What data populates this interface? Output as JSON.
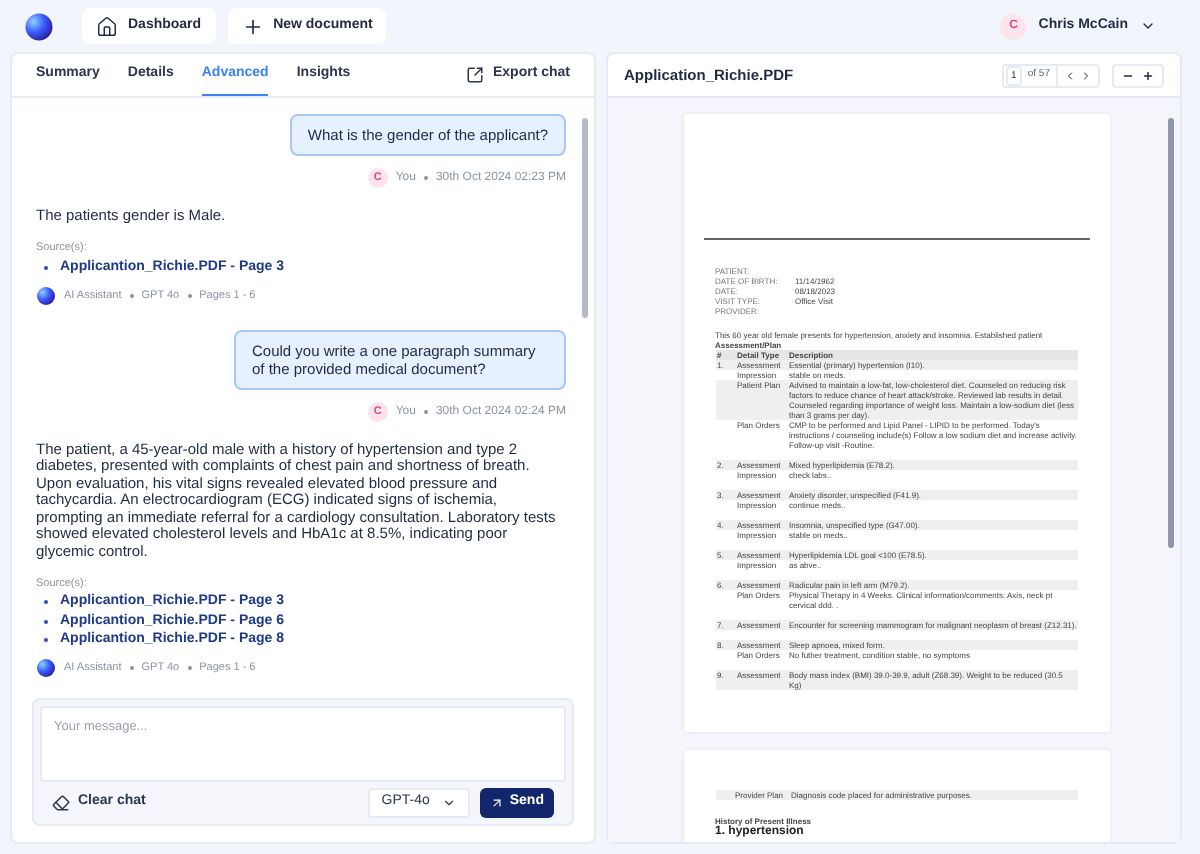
{
  "nav": {
    "buttons": [
      {
        "kind": "home",
        "label": "Dashboard"
      },
      {
        "kind": "plus",
        "label": "New document"
      }
    ],
    "user": {
      "initial": "C",
      "name": "Chris McCain"
    }
  },
  "chat": {
    "tabs": [
      {
        "label": "Summary",
        "selected": false
      },
      {
        "label": "Details",
        "selected": false
      },
      {
        "label": "Advanced",
        "selected": true
      },
      {
        "label": "Insights",
        "selected": false
      }
    ],
    "export": "Export chat",
    "messages": [
      {
        "kind": "user",
        "text": "What is the gender of the applicant?",
        "initial": "C",
        "author": "You",
        "time": "30th Oct 2024 02:23 PM"
      },
      {
        "kind": "assistant",
        "text": "The patients gender is Male.",
        "sources_label": "Source(s):",
        "sources": [
          "Applicantion_Richie.PDF - Page 3"
        ],
        "author": "AI Assistant",
        "model": "GPT 4o",
        "pages": "Pages 1 - 6"
      },
      {
        "kind": "user",
        "text": "Could you write a one paragraph summary of the provided medical document?",
        "initial": "C",
        "author": "You",
        "time": "30th Oct 2024 02:24 PM"
      },
      {
        "kind": "assistant",
        "text": "The patient, a 45-year-old male with a history of hypertension and type 2 diabetes, presented with complaints of chest pain and shortness of breath. Upon evaluation, his vital signs revealed elevated blood pressure and tachycardia. An electrocardiogram (ECG) indicated signs of ischemia, prompting an immediate referral for a cardiology consultation. Laboratory tests showed elevated cholesterol levels and HbA1c at 8.5%, indicating poor glycemic control.",
        "sources_label": "Source(s):",
        "sources": [
          "Applicantion_Richie.PDF - Page 3",
          "Applicantion_Richie.PDF - Page 6",
          "Applicantion_Richie.PDF - Page 8"
        ],
        "author": "AI Assistant",
        "model": "GPT 4o",
        "pages": "Pages 1 - 6"
      }
    ],
    "composer": {
      "placeholder": "Your message...",
      "clear": "Clear chat",
      "model": "GPT-4o",
      "send": "Send"
    }
  },
  "viewer": {
    "title": "Application_Richie.PDF",
    "page": "1",
    "of": "of 57",
    "page1": {
      "fields": [
        {
          "label": "PATIENT:"
        },
        {
          "label": "DATE OF BIRTH:",
          "value": "11/14/1962"
        },
        {
          "label": "DATE:",
          "value": "08/18/2023"
        },
        {
          "label": "VISIT TYPE:",
          "value": "Office Visit"
        },
        {
          "label": "PROVIDER:"
        }
      ],
      "intro": "This 60 year old female presents for hypertension, anxiety and insomnia. Established patient",
      "section": "Assessment/Plan",
      "columns": [
        "#",
        "Detail Type",
        "Description"
      ],
      "rows": [
        {
          "num": "1.",
          "lines": [
            {
              "type": "Assessment",
              "text": "Essential (primary) hypertension (I10)."
            },
            {
              "type": "Impression",
              "text": "stable on meds."
            },
            {
              "type": "Patient Plan",
              "text": "Advised to maintain a low-fat, low-cholesterol diet. Counseled on reducing risk factors to reduce chance of heart attack/stroke. Reviewed lab results in detail. Counseled regarding importance of weight loss. Maintain a low-sodium diet (less than 3 grams per day)."
            },
            {
              "type": "Plan Orders",
              "text": "CMP to be performed and Lipid Panel - LIPID to be performed. Today's instructions / counseling include(s) Follow a low sodium diet and increase activity. Follow-up visit -Routine."
            }
          ]
        },
        {
          "num": "2.",
          "lines": [
            {
              "type": "Assessment",
              "text": "Mixed hyperlipidemia (E78.2)."
            },
            {
              "type": "Impression",
              "text": "check labs.."
            }
          ]
        },
        {
          "num": "3.",
          "lines": [
            {
              "type": "Assessment",
              "text": "Anxiety disorder, unspecified (F41.9)."
            },
            {
              "type": "Impression",
              "text": "continue meds.."
            }
          ]
        },
        {
          "num": "4.",
          "lines": [
            {
              "type": "Assessment",
              "text": "Insomnia, unspecified type (G47.00)."
            },
            {
              "type": "Impression",
              "text": "stable on meds.."
            }
          ]
        },
        {
          "num": "5.",
          "lines": [
            {
              "type": "Assessment",
              "text": "Hyperlipidemia LDL goal <100 (E78.5)."
            },
            {
              "type": "Impression",
              "text": "as abve.."
            }
          ]
        },
        {
          "num": "6.",
          "lines": [
            {
              "type": "Assessment",
              "text": "Radicular pain in left arm (M79.2)."
            },
            {
              "type": "Plan Orders",
              "text": "Physical Therapy in 4 Weeks. Clinical information/comments: Axis, neck pt cervical ddd. ."
            }
          ]
        },
        {
          "num": "7.",
          "lines": [
            {
              "type": "Assessment",
              "text": "Encounter for screening mammogram for malignant neoplasm of breast (Z12.31)."
            }
          ]
        },
        {
          "num": "8.",
          "lines": [
            {
              "type": "Assessment",
              "text": "Sleep apnoea, mixed form."
            },
            {
              "type": "Plan Orders",
              "text": "No futher treatment, condition stable, no symptoms"
            }
          ]
        },
        {
          "num": "9.",
          "lines": [
            {
              "type": "Assessment",
              "text": "Body mass index (BMI) 39.0-39.9, adult (Z68.39). Weight to be reduced (30.5 Kg)"
            }
          ]
        }
      ]
    },
    "page2": {
      "plan_label": "Provider Plan",
      "plan_text": "Diagnosis code placed for administrative purposes.",
      "history": "History of Present Illness",
      "heading": "1. hypertension"
    }
  }
}
